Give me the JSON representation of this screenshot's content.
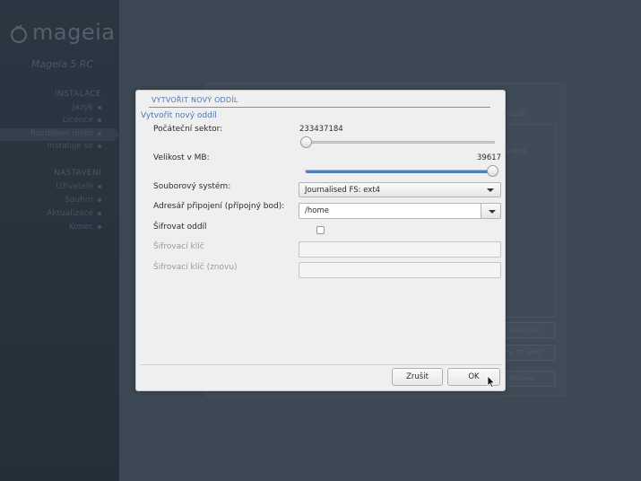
{
  "sidebar": {
    "logo_text": "mageia",
    "version": "Mageia 5 RC",
    "sections": [
      {
        "heading": "INSTALACE",
        "items": [
          "Jazyk",
          "Licence",
          "Rozdělení disků",
          "Instaluje se"
        ]
      },
      {
        "heading": "NASTAVENÍ",
        "items": [
          "Uživatelé",
          "Souhrn",
          "Aktualizace",
          "Konec"
        ]
      }
    ]
  },
  "background": {
    "text_1": "rozdíl",
    "text_2": "volné",
    "buttons": [
      "rozmístit",
      "y \"znalec\"",
      "Hotovo"
    ]
  },
  "dialog": {
    "title": "VYTVOŘIT NOVÝ ODDÍL",
    "subtitle": "Vytvořit nový oddíl",
    "start_sector": {
      "label": "Počáteční sektor:",
      "value": "233437184",
      "fraction": 0.0
    },
    "size_mb": {
      "label": "Velikost v MB:",
      "value": "39617",
      "fraction": 1.0
    },
    "filesystem": {
      "label": "Souborový systém:",
      "value": "Journalised FS: ext4"
    },
    "mount_point": {
      "label": "Adresář připojení (přípojný bod):",
      "value": "/home"
    },
    "encrypt": {
      "label": "Šifrovat oddíl",
      "checked": false
    },
    "key": {
      "label": "Šifrovací klíč",
      "value": ""
    },
    "key_again": {
      "label": "Šifrovací klíč (znovu)",
      "value": ""
    },
    "cancel_label": "Zrušit",
    "ok_label": "OK"
  },
  "colors": {
    "accent": "#4a78b8",
    "slider_fill": "#4d7dbf",
    "background": "#3c4853"
  }
}
